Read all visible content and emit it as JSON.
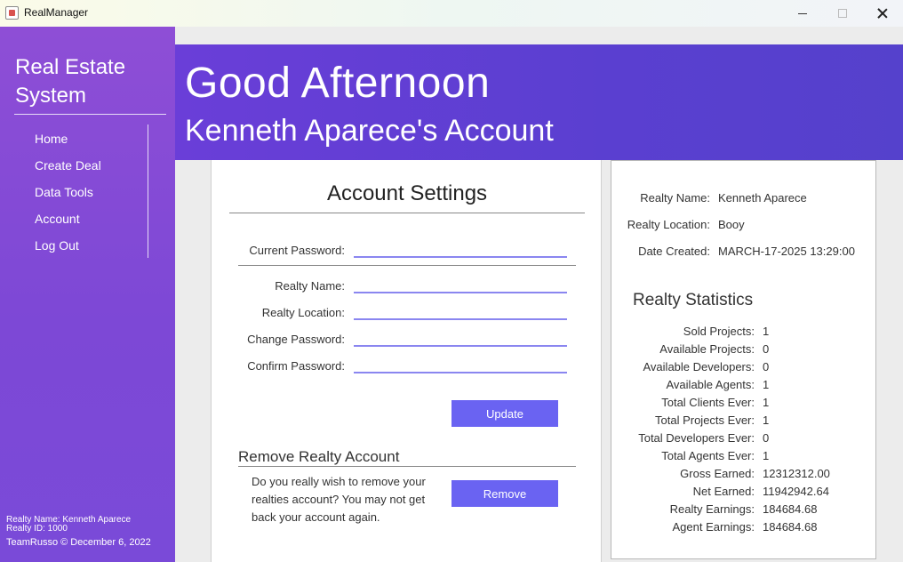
{
  "window": {
    "title": "RealManager"
  },
  "sidebar": {
    "brand_line1": "Real Estate",
    "brand_line2": "System",
    "items": [
      {
        "label": "Home"
      },
      {
        "label": "Create Deal"
      },
      {
        "label": "Data Tools"
      },
      {
        "label": "Account"
      },
      {
        "label": "Log Out"
      }
    ],
    "realty_name": "Realty Name: Kenneth Aparece",
    "realty_id": "Realty ID: 1000",
    "copyright": "TeamRusso © December 6, 2022"
  },
  "header": {
    "greeting": "Good Afternoon",
    "account": "Kenneth Aparece's Account"
  },
  "settings": {
    "title": "Account Settings",
    "current_password_label": "Current Password:",
    "realty_name_label": "Realty Name:",
    "realty_location_label": "Realty Location:",
    "change_password_label": "Change Password:",
    "confirm_password_label": "Confirm Password:",
    "update_label": "Update",
    "remove_title": "Remove Realty Account",
    "remove_text": "Do you really wish to remove your realties account? You may not get back your account again.",
    "remove_label": "Remove"
  },
  "info": {
    "realty_name_label": "Realty Name:",
    "realty_name": "Kenneth Aparece",
    "realty_location_label": "Realty Location:",
    "realty_location": "Booy",
    "date_created_label": "Date Created:",
    "date_created": "MARCH-17-2025 13:29:00"
  },
  "stats": {
    "title": "Realty Statistics",
    "rows": [
      {
        "label": "Sold Projects:",
        "value": "1"
      },
      {
        "label": "Available Projects:",
        "value": "0"
      },
      {
        "label": "Available Developers:",
        "value": "0"
      },
      {
        "label": "Available Agents:",
        "value": "1"
      },
      {
        "label": "Total Clients Ever:",
        "value": "1"
      },
      {
        "label": "Total Projects Ever:",
        "value": "1"
      },
      {
        "label": "Total Developers Ever:",
        "value": "0"
      },
      {
        "label": "Total Agents Ever:",
        "value": "1"
      },
      {
        "label": "Gross Earned:",
        "value": "12312312.00"
      },
      {
        "label": "Net Earned:",
        "value": "11942942.64"
      },
      {
        "label": "Realty Earnings:",
        "value": "184684.68"
      },
      {
        "label": "Agent Earnings:",
        "value": "184684.68"
      }
    ]
  },
  "colors": {
    "sidebar": "#8e4ed6",
    "header": "#5a3fd0",
    "button": "#6a63f2",
    "input_underline": "#8a86f0"
  }
}
